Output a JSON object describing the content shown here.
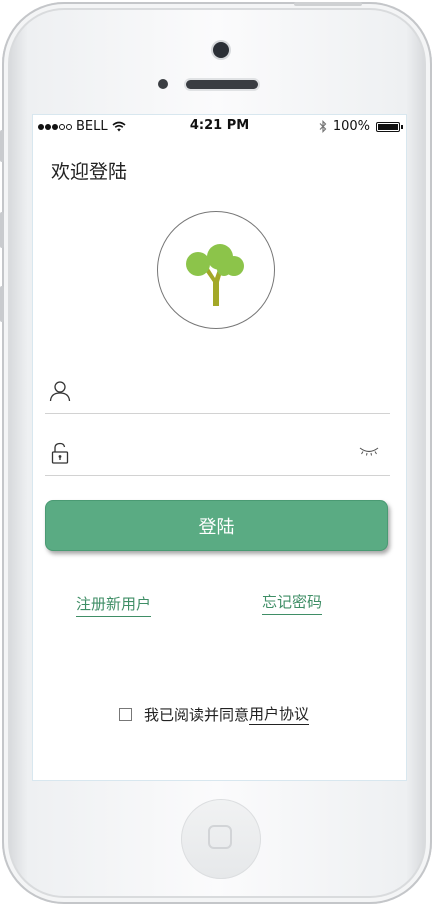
{
  "status_bar": {
    "carrier": "BELL",
    "time": "4:21 PM",
    "battery": "100%"
  },
  "login": {
    "title": "欢迎登陆",
    "submit_label": "登陆",
    "register_link": "注册新用户",
    "forgot_link": "忘记密码",
    "agreement_prefix": "我已阅读并同意",
    "agreement_link": "用户协议",
    "agreement_checked": false
  },
  "colors": {
    "accent": "#5aab83",
    "link": "#3f8e66"
  },
  "icons": {
    "username_field": "user-icon",
    "password_field": "lock-icon",
    "password_toggle": "eye-closed-icon",
    "logo": "tree-icon"
  }
}
